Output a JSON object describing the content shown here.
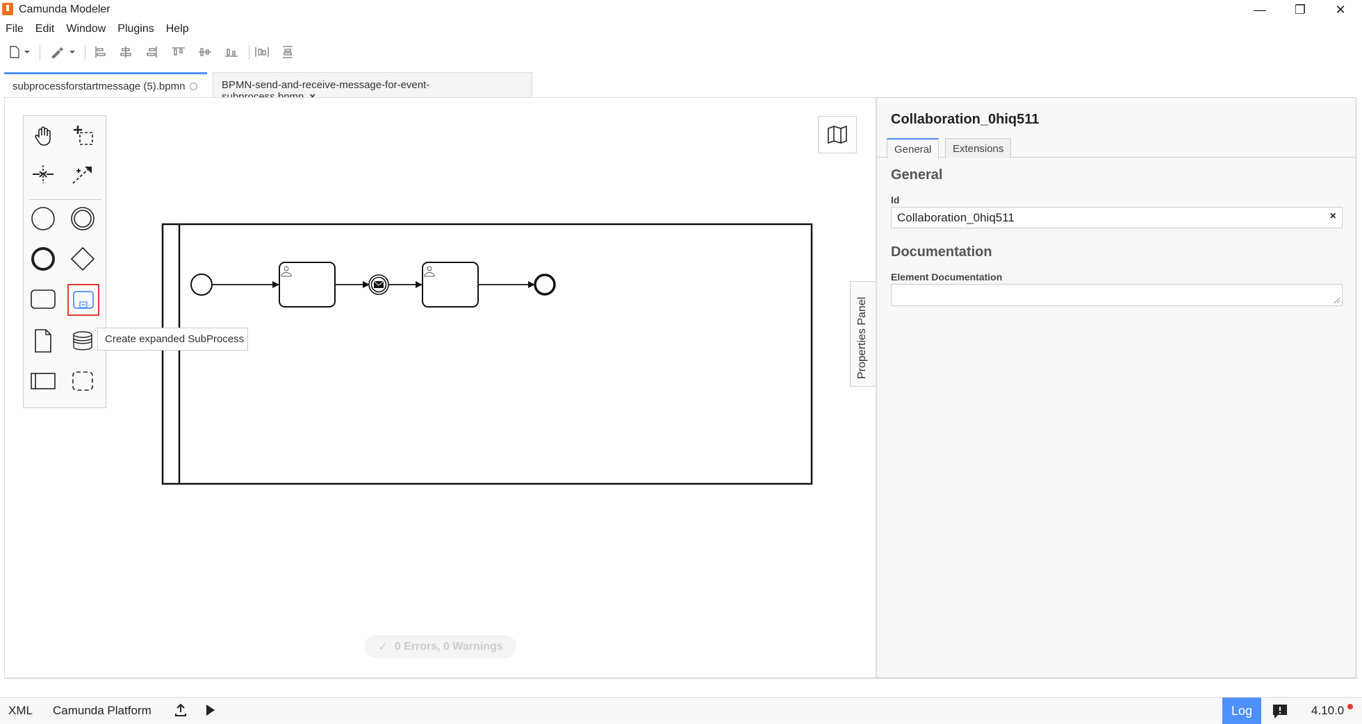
{
  "window": {
    "title": "Camunda Modeler",
    "controls": {
      "minimize": "—",
      "restore": "❐",
      "close": "✕"
    }
  },
  "menu": {
    "items": [
      "File",
      "Edit",
      "Window",
      "Plugins",
      "Help"
    ]
  },
  "toolbar": {
    "icons": [
      "new-file-icon",
      "chevron-down-icon",
      "color-picker-icon",
      "chevron-down-icon",
      "align-left-icon",
      "align-center-icon",
      "align-right-icon",
      "align-top-icon",
      "align-middle-icon",
      "align-bottom-icon",
      "distribute-horizontal-icon",
      "distribute-vertical-icon"
    ]
  },
  "tabs": [
    {
      "label": "subprocessforstartmessage (5).bpmn",
      "active": true
    },
    {
      "label": "BPMN-send-and-receive-message-for-event-subprocess.bpmn",
      "active": false,
      "close": "×"
    }
  ],
  "palette": {
    "tools": [
      "hand-tool-icon",
      "lasso-tool-icon",
      "space-tool-icon",
      "global-connect-icon",
      "start-event-icon",
      "intermediate-event-icon",
      "end-event-icon",
      "gateway-icon",
      "task-icon",
      "expanded-subprocess-icon",
      "data-object-icon",
      "data-store-icon",
      "pool-icon",
      "group-icon"
    ],
    "tooltip": "Create expanded SubProcess",
    "highlight_color": "#e53935"
  },
  "canvas": {
    "status": "0 Errors, 0 Warnings",
    "minimap_icon": "map-icon"
  },
  "properties_panel": {
    "toggle_label": "Properties Panel",
    "title": "Collaboration_0hiq511",
    "tabs": [
      "General",
      "Extensions"
    ],
    "general_group": "General",
    "id_label": "Id",
    "id_value": "Collaboration_0hiq511",
    "clear_label": "×",
    "documentation_group": "Documentation",
    "doc_label": "Element Documentation"
  },
  "bottom_bar": {
    "xml": "XML",
    "platform": "Camunda Platform",
    "log": "Log",
    "version": "4.10.0",
    "accent": "#4d90fe"
  }
}
